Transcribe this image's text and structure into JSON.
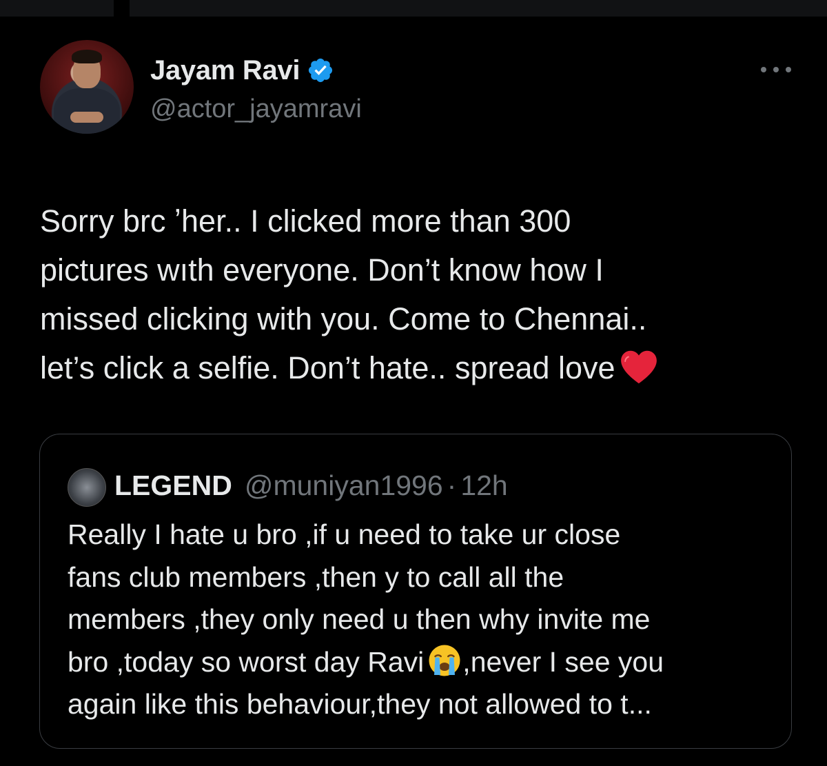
{
  "tweet": {
    "author": {
      "display_name": "Jayam Ravi",
      "handle": "@actor_jayamravi",
      "verified": true
    },
    "text": "Sorry brc ʼher.. I clicked more than 300\npictures wıth everyone. Don’t know how I\nmissed clicking with you. Come to Chennai..\nlet’s click a selfie. Don’t hate.. spread love",
    "trailing_emoji": "red-heart"
  },
  "quoted_tweet": {
    "author": {
      "display_name": "LEGEND",
      "handle": "@muniyan1996",
      "separator": "·",
      "time": "12h"
    },
    "text_part1": "Really I hate u bro ,if u need to take ur close\nfans club members ,then y to call all the\nmembers ,they only need u then why invite me\nbro ,today so worst day Ravi",
    "inline_emoji": "loudly-crying-face",
    "text_part2": ",never I see you\nagain like this behaviour,they not allowed to t..."
  },
  "colors": {
    "background": "#000000",
    "text_primary": "#e7e9ea",
    "text_secondary": "#71767b",
    "verified_badge": "#1d9bf0",
    "border": "#3a3d42",
    "heart": "#e5243b"
  },
  "icons": {
    "verified": "verified-badge-icon",
    "more": "more-options-icon"
  }
}
